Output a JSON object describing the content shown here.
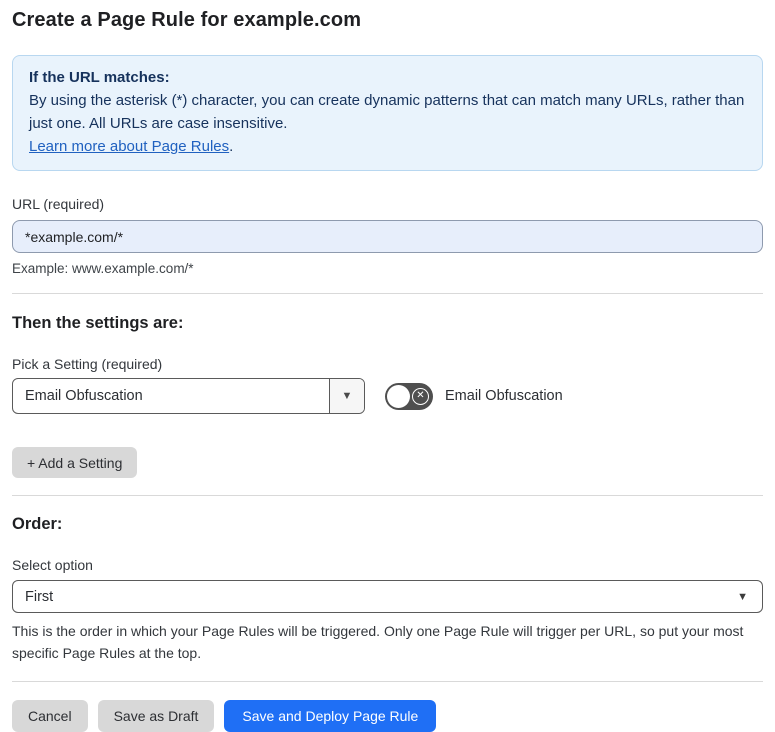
{
  "page": {
    "title": "Create a Page Rule for example.com"
  },
  "info_box": {
    "heading": "If the URL matches:",
    "body": "By using the asterisk (*) character, you can create dynamic patterns that can match many URLs, rather than just one. All URLs are case insensitive.",
    "link_label": "Learn more about Page Rules",
    "link_suffix": "."
  },
  "url_field": {
    "label": "URL (required)",
    "value": "*example.com/*",
    "helper": "Example: www.example.com/*"
  },
  "settings_section": {
    "heading": "Then the settings are:",
    "picker_label": "Pick a Setting (required)",
    "picker_value": "Email Obfuscation",
    "picker_arrow_icon": "▼",
    "toggle_state": "off",
    "toggle_off_icon": "✕",
    "toggle_label": "Email Obfuscation",
    "add_setting_label": "+ Add a Setting"
  },
  "order_section": {
    "heading": "Order:",
    "select_label": "Select option",
    "select_value": "First",
    "select_arrow_icon": "▼",
    "helper": "This is the order in which your Page Rules will be triggered. Only one Page Rule will trigger per URL, so put your most specific Page Rules at the top."
  },
  "footer": {
    "cancel_label": "Cancel",
    "save_draft_label": "Save as Draft",
    "save_deploy_label": "Save and Deploy Page Rule"
  },
  "colors": {
    "accent_blue": "#1f6ff5",
    "info_bg": "#e9f3fc",
    "info_border": "#b8d7f0",
    "info_text": "#16325c",
    "link_blue": "#2061c0",
    "input_bg": "#e7eefb",
    "toggle_off_bg": "#4f4f4f",
    "gray_button_bg": "#d8d8d8"
  }
}
